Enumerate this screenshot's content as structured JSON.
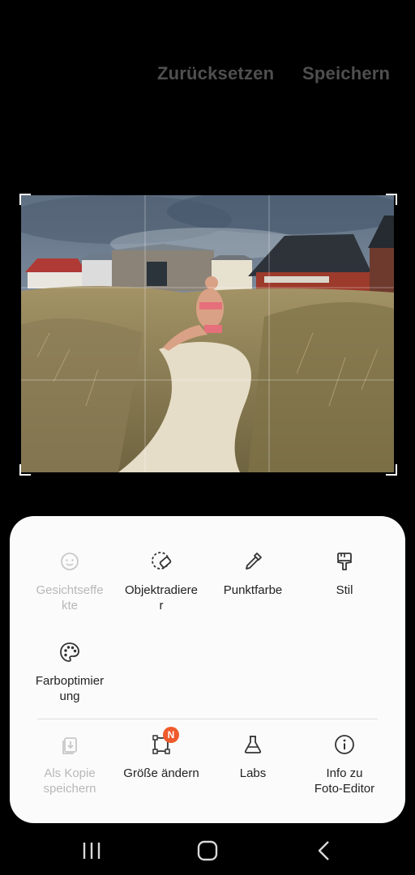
{
  "header": {
    "reset_label": "Zurücksetzen",
    "save_label": "Speichern"
  },
  "photo": {
    "description_icon": "photo-beach-dunes"
  },
  "menu": {
    "row1": [
      {
        "label": "Gesichtseffekte",
        "display": "Gesichtseffe\nkte",
        "icon": "face-icon",
        "enabled": false
      },
      {
        "label": "Objektradierer",
        "display": "Objektradiere\nr",
        "icon": "eraser-icon",
        "enabled": true
      },
      {
        "label": "Punktfarbe",
        "display": "Punktfarbe",
        "icon": "dropper-icon",
        "enabled": true
      },
      {
        "label": "Stil",
        "display": "Stil",
        "icon": "paint-brush-icon",
        "enabled": true
      }
    ],
    "row2": [
      {
        "label": "Farboptimierung",
        "display": "Farboptimier\nung",
        "icon": "palette-icon",
        "enabled": true
      }
    ],
    "row3": [
      {
        "label": "Als Kopie speichern",
        "display": "Als Kopie\nspeichern",
        "icon": "save-copy-icon",
        "enabled": false
      },
      {
        "label": "Größe ändern",
        "display": "Größe ändern",
        "icon": "resize-icon",
        "enabled": true,
        "badge": "N"
      },
      {
        "label": "Labs",
        "display": "Labs",
        "icon": "flask-icon",
        "enabled": true
      },
      {
        "label": "Info zu Foto-Editor",
        "display": "Info zu\nFoto-Editor",
        "icon": "info-icon",
        "enabled": true
      }
    ]
  },
  "colors": {
    "sheet_bg": "#fbfbfb",
    "badge": "#ef5b2c",
    "disabled_text": "#b8b8b8",
    "header_text": "#4f4f4f"
  },
  "navbar": {
    "recents_icon": "recents-icon",
    "home_icon": "home-icon",
    "back_icon": "back-icon"
  }
}
